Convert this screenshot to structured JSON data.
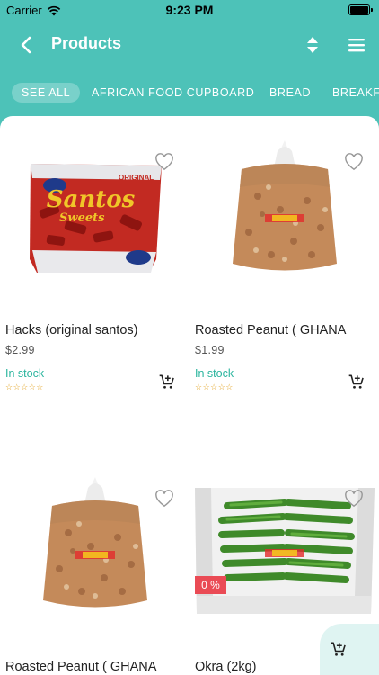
{
  "status_bar": {
    "carrier": "Carrier",
    "time": "9:23 PM"
  },
  "nav": {
    "title": "Products"
  },
  "tabs": [
    {
      "label": "SEE ALL",
      "active": true
    },
    {
      "label": "AFRICAN FOOD CUPBOARD",
      "active": false
    },
    {
      "label": "BREAD",
      "active": false
    },
    {
      "label": "BREAKFAST",
      "active": false
    }
  ],
  "products": [
    {
      "name": "Hacks (original santos)",
      "price": "$2.99",
      "stock": "In stock",
      "rating": "☆☆☆☆☆",
      "image": "santos-candy-bag"
    },
    {
      "name": "Roasted Peanut ( GHANA",
      "price": "$1.99",
      "stock": "In stock",
      "rating": "☆☆☆☆☆",
      "image": "peanut-bag"
    },
    {
      "name": "Roasted Peanut ( GHANA",
      "image": "peanut-bag"
    },
    {
      "name": "Okra (2kg)",
      "discount": "0 %",
      "image": "okra-box"
    }
  ],
  "images": {
    "candy_brand": "Santos",
    "candy_sub": "Sweets",
    "candy_tag": "ORIGINAL"
  },
  "colors": {
    "header": "#4dc2b8",
    "stock": "#2bb59e",
    "discount": "#ea4b55",
    "stars": "#e3a425",
    "fab": "#dff4f2"
  }
}
